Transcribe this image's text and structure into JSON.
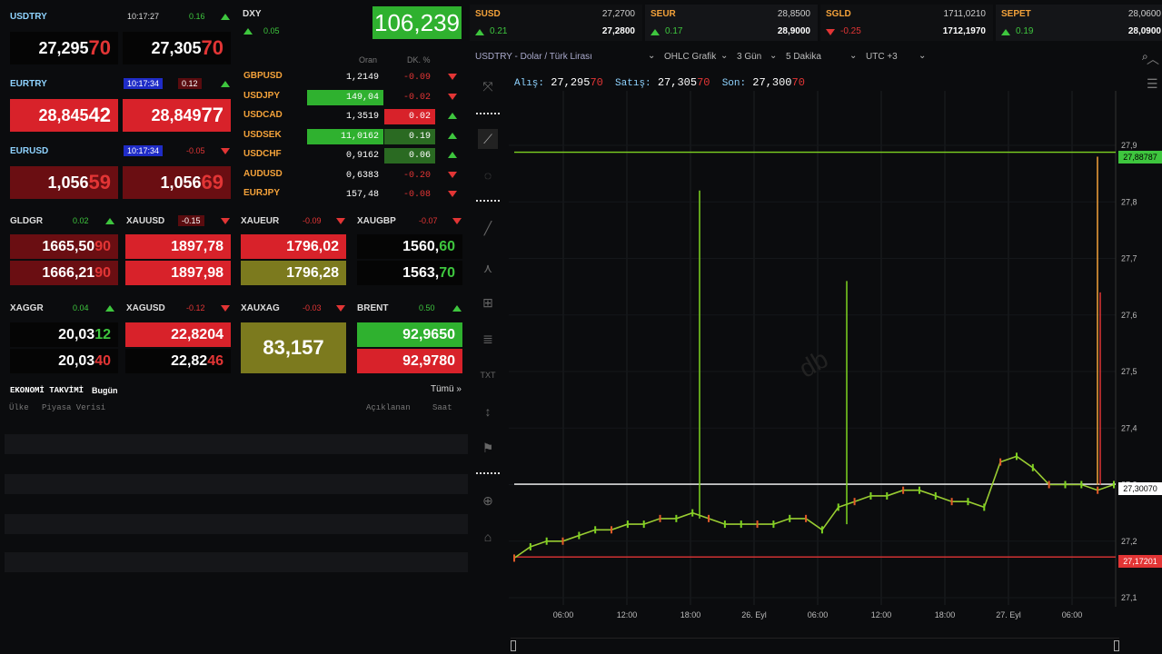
{
  "quotes": {
    "usdtry": {
      "name": "USDTRY",
      "time": "10:17:27",
      "change": "0.16",
      "bid_main": "27,295",
      "bid_tail": "70",
      "ask_main": "27,305",
      "ask_tail": "70"
    },
    "eurtry": {
      "name": "EURTRY",
      "time": "10:17:34",
      "change": "0.12",
      "bid_main": "28,845",
      "bid_tail": "42",
      "ask_main": "28,849",
      "ask_tail": "77"
    },
    "eurusd": {
      "name": "EURUSD",
      "time": "10:17:34",
      "change": "-0.05",
      "bid_main": "1,056",
      "bid_tail": "59",
      "ask_main": "1,056",
      "ask_tail": "69"
    }
  },
  "dxy": {
    "name": "DXY",
    "change": "0.05",
    "value": "106,239"
  },
  "fx_table": {
    "headers": [
      "Oran",
      "DK. %"
    ],
    "rows": [
      {
        "name": "GBPUSD",
        "rate": "1,2149",
        "chg": "-0.09",
        "dir": "down"
      },
      {
        "name": "USDJPY",
        "rate": "149,04",
        "chg": "-0.02",
        "dir": "down"
      },
      {
        "name": "USDCAD",
        "rate": "1,3519",
        "chg": "0.02",
        "dir": "up"
      },
      {
        "name": "USDSEK",
        "rate": "11,0162",
        "chg": "0.19",
        "dir": "up"
      },
      {
        "name": "USDCHF",
        "rate": "0,9162",
        "chg": "0.06",
        "dir": "up"
      },
      {
        "name": "AUDUSD",
        "rate": "0,6383",
        "chg": "-0.20",
        "dir": "down"
      },
      {
        "name": "EURJPY",
        "rate": "157,48",
        "chg": "-0.08",
        "dir": "down"
      }
    ]
  },
  "metals": {
    "gldgr": {
      "name": "GLDGR",
      "change": "0.02",
      "v1_main": "1665,50",
      "v1_tail": "90",
      "v2_main": "1666,21",
      "v2_tail": "90"
    },
    "xauusd": {
      "name": "XAUUSD",
      "change": "-0.15",
      "v1": "1897,78",
      "v2": "1897,98"
    },
    "xaueur": {
      "name": "XAUEUR",
      "change": "-0.09",
      "v1": "1796,02",
      "v2": "1796,28"
    },
    "xaugbp": {
      "name": "XAUGBP",
      "change": "-0.07",
      "v1_main": "1560,",
      "v1_tail": "60",
      "v2_main": "1563,",
      "v2_tail": "70"
    },
    "xaggr": {
      "name": "XAGGR",
      "change": "0.04",
      "v1_main": "20,03",
      "v1_tail": "12",
      "v2_main": "20,03",
      "v2_tail": "40"
    },
    "xagusd": {
      "name": "XAGUSD",
      "change": "-0.12",
      "v1": "22,8204",
      "v2_main": "22,82",
      "v2_tail": "46"
    },
    "xauxag": {
      "name": "XAUXAG",
      "change": "-0.03",
      "value": "83,157"
    },
    "brent": {
      "name": "BRENT",
      "change": "0.50",
      "v1": "92,9650",
      "v2": "92,9780"
    }
  },
  "calendar": {
    "title": "EKONOMİ TAKVİMİ",
    "subtitle": "Bugün",
    "all_link": "Tümü »",
    "cols": [
      "Ülke",
      "Piyasa Verisi",
      "Açıklanan",
      "Saat"
    ]
  },
  "top_quotes": [
    {
      "name": "SUSD",
      "v1": "27,2700",
      "change": "0.21",
      "v2": "27,2800",
      "dir": "up"
    },
    {
      "name": "SEUR",
      "v1": "28,8500",
      "change": "0.17",
      "v2": "28,9000",
      "dir": "up"
    },
    {
      "name": "SGLD",
      "v1": "1711,0210",
      "change": "-0.25",
      "v2": "1712,1970",
      "dir": "down"
    },
    {
      "name": "SEPET",
      "v1": "28,0600",
      "change": "0.19",
      "v2": "28,0900",
      "dir": "up"
    }
  ],
  "chart_toolbar": {
    "symbol": "USDTRY - Dolar / Türk Lirası",
    "type": "OHLC Grafik",
    "period": "3 Gün",
    "interval": "5 Dakika",
    "tz": "UTC +3"
  },
  "chart_info": {
    "alis_label": "Alış:",
    "alis": "27,295",
    "alis_tail": "70",
    "satis_label": "Satış:",
    "satis": "27,305",
    "satis_tail": "70",
    "son_label": "Son:",
    "son": "27,300",
    "son_tail": "70"
  },
  "watermark": "db",
  "price_tags": {
    "top": "27,88787",
    "current": "27,30070",
    "bottom": "27,17201"
  },
  "colors": {
    "green": "#3ec63e",
    "red": "#e23535",
    "orange": "#f4a23a",
    "blue_label": "#8fd3ff"
  },
  "chart_data": {
    "type": "line",
    "ylim": [
      27.1,
      27.9
    ],
    "y_ticks": [
      "27,9",
      "27,8",
      "27,7",
      "27,6",
      "27,5",
      "27,4",
      "27,3",
      "27,2",
      "27,1"
    ],
    "x_ticks": [
      "06:00",
      "12:00",
      "18:00",
      "26. Eyl",
      "06:00",
      "12:00",
      "18:00",
      "27. Eyl",
      "06:00"
    ],
    "hlines": [
      27.88787,
      27.3007,
      27.17201
    ],
    "series": [
      {
        "values": [
          27.17,
          27.19,
          27.2,
          27.2,
          27.21,
          27.22,
          27.22,
          27.23,
          27.23,
          27.24,
          27.24,
          27.25,
          27.24,
          27.23,
          27.23,
          27.23,
          27.23,
          27.24,
          27.24,
          27.22,
          27.26,
          27.27,
          27.28,
          27.28,
          27.29,
          27.29,
          27.28,
          27.27,
          27.27,
          27.26,
          27.34,
          27.35,
          27.33,
          27.3,
          27.3,
          27.3,
          27.29,
          27.3
        ]
      }
    ]
  }
}
